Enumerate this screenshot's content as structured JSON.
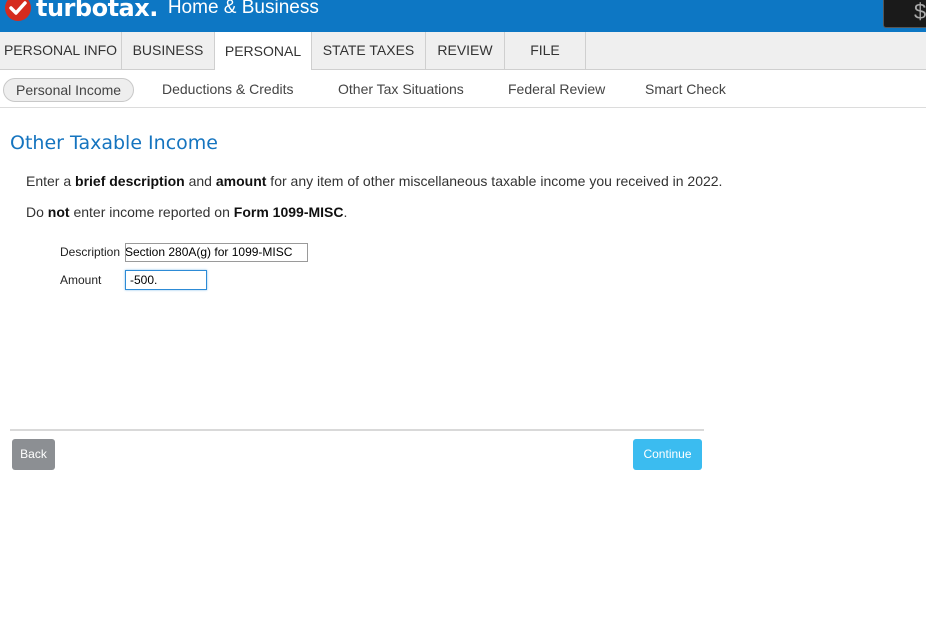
{
  "brand": {
    "name": "turbotax.",
    "edition": "Home & Business",
    "accent": "#0d77c4",
    "check_color": "#d52b1e"
  },
  "header": {
    "balance_symbol": "$"
  },
  "nav": {
    "tabs": [
      {
        "label": "PERSONAL INFO",
        "active": false
      },
      {
        "label": "BUSINESS",
        "active": false
      },
      {
        "label": "PERSONAL",
        "active": true
      },
      {
        "label": "STATE TAXES",
        "active": false
      },
      {
        "label": "REVIEW",
        "active": false
      },
      {
        "label": "FILE",
        "active": false
      }
    ]
  },
  "subnav": {
    "tabs": [
      {
        "label": "Personal Income",
        "active": true
      },
      {
        "label": "Deductions & Credits",
        "active": false
      },
      {
        "label": "Other Tax Situations",
        "active": false
      },
      {
        "label": "Federal Review",
        "active": false
      },
      {
        "label": "Smart Check",
        "active": false
      }
    ]
  },
  "main": {
    "title": "Other Taxable Income",
    "intro": {
      "p1": "Enter a ",
      "p1_bold1": "brief description",
      "p1_mid": " and ",
      "p1_bold2": "amount",
      "p1_end": " for any item of other miscellaneous taxable income you received in 2022."
    },
    "warning": {
      "p1": "Do ",
      "p1_bold1": "not",
      "p1_mid": " enter income reported on ",
      "p1_bold2": "Form 1099-MISC",
      "p1_end": "."
    },
    "form": {
      "description_label": "Description",
      "description_value": "Section 280A(g) for 1099-MISC",
      "amount_label": "Amount",
      "amount_value": "-500."
    }
  },
  "footer": {
    "back_label": "Back",
    "continue_label": "Continue"
  }
}
